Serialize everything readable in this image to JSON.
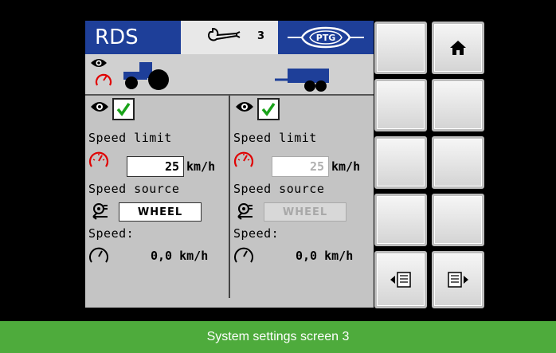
{
  "header": {
    "title": "RDS",
    "tool_icon": "wrench-icon",
    "screen_number": "3",
    "logo": "PTG"
  },
  "left": {
    "visible_checked": true,
    "speed_limit_label": "Speed limit",
    "speed_limit_value": "25",
    "unit": "km/h",
    "speed_source_label": "Speed source",
    "speed_source_value": "WHEEL",
    "speed_label": "Speed:",
    "speed_value": "0,0 km/h"
  },
  "right": {
    "visible_checked": true,
    "speed_limit_label": "Speed limit",
    "speed_limit_value": "25",
    "unit": "km/h",
    "speed_source_label": "Speed source",
    "speed_source_value": "WHEEL",
    "speed_label": "Speed:",
    "speed_value": "0,0 km/h",
    "disabled": true
  },
  "softkeys": [
    {
      "icon": ""
    },
    {
      "icon": "home-icon"
    },
    {
      "icon": ""
    },
    {
      "icon": ""
    },
    {
      "icon": ""
    },
    {
      "icon": ""
    },
    {
      "icon": ""
    },
    {
      "icon": ""
    },
    {
      "icon": "previous-page-icon"
    },
    {
      "icon": "next-page-icon"
    }
  ],
  "colors": {
    "accent_blue": "#1e3f99",
    "caption_green": "#4eab3c",
    "gauge_red": "#e00000",
    "check_green": "#1aa31a"
  },
  "caption": "System settings screen 3"
}
